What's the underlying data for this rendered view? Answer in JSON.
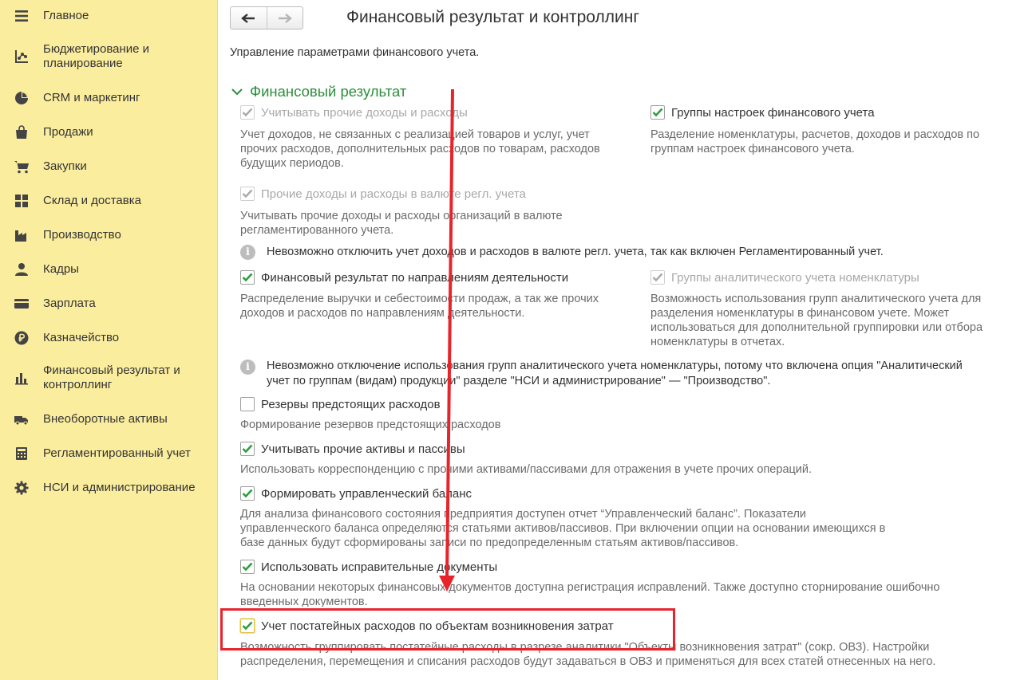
{
  "sidebar": {
    "items": [
      {
        "label": "Главное",
        "icon": "menu-icon"
      },
      {
        "label": "Бюджетирование и планирование",
        "icon": "budget-chart-icon"
      },
      {
        "label": "CRM и маркетинг",
        "icon": "pie-chart-icon"
      },
      {
        "label": "Продажи",
        "icon": "shopping-bag-icon"
      },
      {
        "label": "Закупки",
        "icon": "cart-icon"
      },
      {
        "label": "Склад и доставка",
        "icon": "warehouse-grid-icon"
      },
      {
        "label": "Производство",
        "icon": "factory-icon"
      },
      {
        "label": "Кадры",
        "icon": "person-icon"
      },
      {
        "label": "Зарплата",
        "icon": "wallet-icon"
      },
      {
        "label": "Казначейство",
        "icon": "ruble-coin-icon"
      },
      {
        "label": "Финансовый результат и контроллинг",
        "icon": "bar-chart-icon"
      },
      {
        "label": "Внеоборотные активы",
        "icon": "truck-icon"
      },
      {
        "label": "Регламентированный учет",
        "icon": "calculator-icon"
      },
      {
        "label": "НСИ и администрирование",
        "icon": "gear-icon"
      }
    ]
  },
  "header": {
    "title": "Финансовый результат и контроллинг",
    "subtitle": "Управление параметрами финансового учета."
  },
  "section": {
    "title": "Финансовый результат"
  },
  "options": {
    "other_income": {
      "label": "Учитывать прочие доходы и расходы",
      "checked": true,
      "disabled": true,
      "desc": [
        "Учет доходов, не связанных с реализацией товаров и услуг, учет",
        "прочих расходов, дополнительных расходов по товарам, расходов",
        "будущих периодов."
      ]
    },
    "settings_groups": {
      "label": "Группы настроек финансового учета",
      "checked": true,
      "disabled": false,
      "desc": [
        "Разделение номенклатуры, расчетов, доходов и расходов по",
        "группам настроек финансового учета."
      ]
    },
    "currency": {
      "label": "Прочие доходы и расходы в валюте регл. учета",
      "checked": true,
      "disabled": true,
      "desc": [
        "Учитывать прочие доходы и расходы организаций в валюте",
        "регламентированного учета."
      ]
    },
    "directions": {
      "label": "Финансовый результат по направлениям деятельности",
      "checked": true,
      "disabled": false,
      "desc": [
        "Распределение выручки и себестоимости продаж, а так же прочих",
        "доходов и расходов по направлениям деятельности."
      ]
    },
    "analytic_groups": {
      "label": "Группы аналитического учета номенклатуры",
      "checked": true,
      "disabled": true,
      "desc": [
        "Возможность использования групп аналитического учета для",
        "разделения номенклатуры в финансовом учете. Может",
        "использоваться для дополнительной группировки или отбора",
        "номенклатуры в отчетах."
      ]
    },
    "reserves": {
      "label": "Резервы предстоящих расходов",
      "checked": false,
      "disabled": false,
      "desc": [
        "Формирование резервов предстоящих расходов"
      ]
    },
    "other_assets": {
      "label": "Учитывать прочие активы и пассивы",
      "checked": true,
      "disabled": false,
      "desc": [
        "Использовать корреспонденцию с прочими активами/пассивами для отражения в учете прочих операций."
      ]
    },
    "mgmt_balance": {
      "label": "Формировать управленческий баланс",
      "checked": true,
      "disabled": false,
      "desc": [
        "Для анализа финансового состояния предприятия доступен отчет “Управленческий баланс”. Показатели",
        "управленческого баланса определяются статьями активов/пассивов. При включении опции на основании имеющихся в",
        "базе данных будут сформированы записи по предопределенным статьям активов/пассивов."
      ]
    },
    "corrective_docs": {
      "label": "Использовать исправительные документы",
      "checked": true,
      "disabled": false,
      "desc": [
        "На основании некоторых финансовых документов доступна регистрация исправлений. Также доступно сторнирование ошибочно",
        "введенных документов."
      ]
    },
    "cost_objects": {
      "label": "Учет постатейных расходов по объектам возникновения затрат",
      "checked": true,
      "disabled": false,
      "desc": [
        "Возможность группировать постатейные расходы в разрезе аналитики \"Объекты возникновения затрат\" (сокр. ОВЗ). Настройки",
        "распределения, перемещения и списания расходов будут задаваться в ОВЗ и применяться для всех статей отнесенных на него."
      ]
    }
  },
  "notes": {
    "currency_note": "Невозможно отключить учет доходов и расходов в валюте регл. учета, так как включен Регламентированный учет.",
    "analytic_note": [
      "Невозможно отключение использования групп аналитического учета номенклатуры, потому что включена опция \"Аналитический",
      "учет по группам (видам) продукции\" разделе \"НСИ и администрирование\" — \"Производство\"."
    ]
  },
  "colors": {
    "sidebar_bg": "#fbed9e",
    "section_green": "#2d8e3c",
    "check_green": "#2e9e3e",
    "highlight_red": "#e8242b"
  }
}
